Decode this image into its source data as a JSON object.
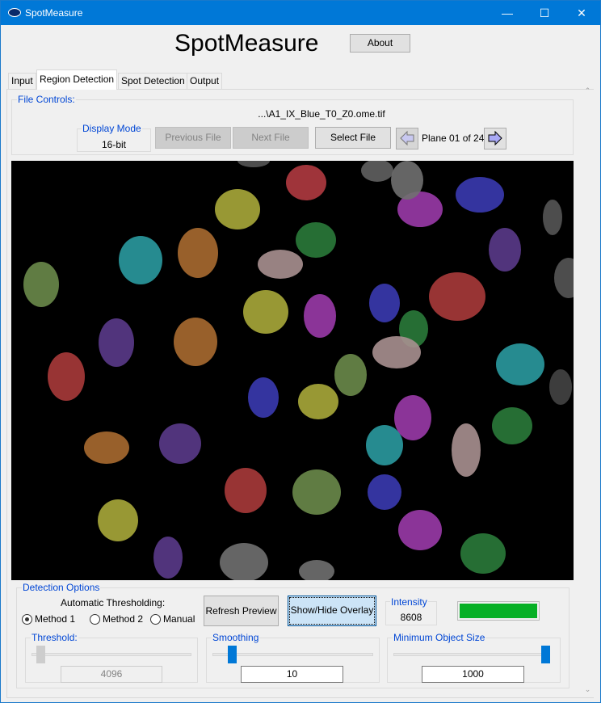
{
  "window": {
    "title": "SpotMeasure",
    "minimize": "—",
    "maximize": "☐",
    "close": "✕"
  },
  "header": {
    "title": "SpotMeasure",
    "about_label": "About"
  },
  "tabs": [
    {
      "label": "Input"
    },
    {
      "label": "Region Detection",
      "active": true
    },
    {
      "label": "Spot Detection"
    },
    {
      "label": "Output"
    }
  ],
  "file_controls": {
    "label": "File Controls:",
    "filename": "...\\A1_IX_Blue_T0_Z0.ome.tif",
    "display_mode_label": "Display Mode",
    "display_mode_value": "16-bit",
    "previous_label": "Previous File",
    "next_label": "Next File",
    "select_label": "Select File",
    "plane_text": "Plane 01 of 24",
    "prev_plane_icon": "arrow-left-icon",
    "next_plane_icon": "arrow-right-icon"
  },
  "detection": {
    "label": "Detection Options",
    "auto_label": "Automatic Thresholding:",
    "methods": [
      {
        "label": "Method 1",
        "checked": true
      },
      {
        "label": "Method 2",
        "checked": false
      },
      {
        "label": "Manual",
        "checked": false
      }
    ],
    "refresh_label": "Refresh Preview",
    "overlay_label": "Show/Hide Overlay",
    "intensity_label": "Intensity",
    "intensity_value": "8608",
    "intensity_color": "#06b025",
    "threshold": {
      "label": "Threshold:",
      "value": "4096",
      "enabled": false,
      "slider_fraction": 0.03
    },
    "smoothing": {
      "label": "Smoothing",
      "value": "10",
      "slider_fraction": 0.1
    },
    "min_size": {
      "label": "Minimum Object Size",
      "value": "1000",
      "slider_fraction": 1.0
    }
  },
  "colors": {
    "accent": "#0078d7",
    "group_label": "#0046d5"
  }
}
